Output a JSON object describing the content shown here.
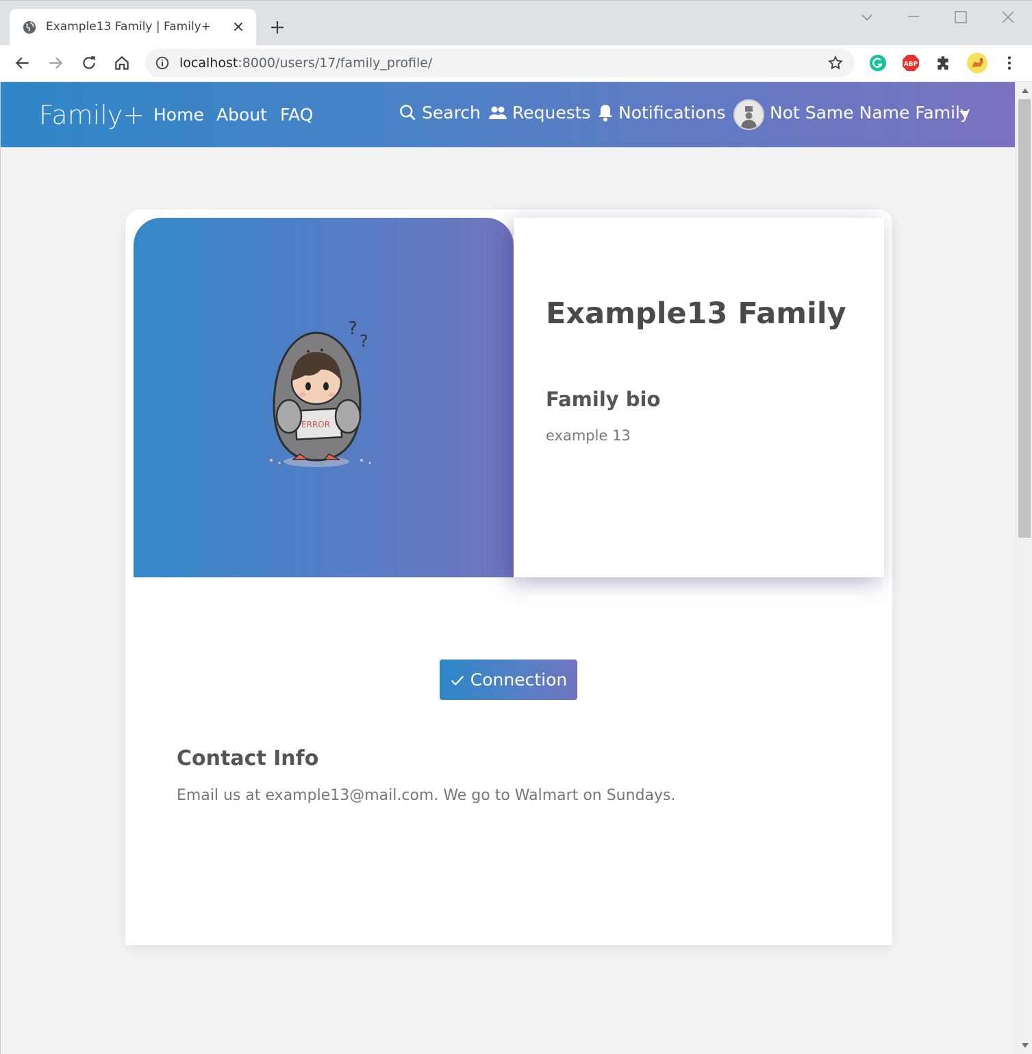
{
  "browser": {
    "tab_title": "Example13 Family | Family+",
    "url_host": "localhost",
    "url_path": ":8000/users/17/family_profile/"
  },
  "navbar": {
    "brand": "Family+",
    "links": [
      "Home",
      "About",
      "FAQ"
    ],
    "search_label": "Search",
    "requests_label": "Requests",
    "notifications_label": "Notifications",
    "user_name": "Not Same Name Family"
  },
  "profile": {
    "family_name": "Example13 Family",
    "bio_heading": "Family bio",
    "bio_text": "example 13",
    "connection_button": "Connection",
    "contact_heading": "Contact Info",
    "contact_text": "Email us at example13@mail.com. We go to Walmart on Sundays.",
    "image_text": "ERROR"
  },
  "colors": {
    "gradient_start": "#2f86c8",
    "gradient_end": "#7a72bf",
    "page_bg": "#f3f3f3"
  }
}
